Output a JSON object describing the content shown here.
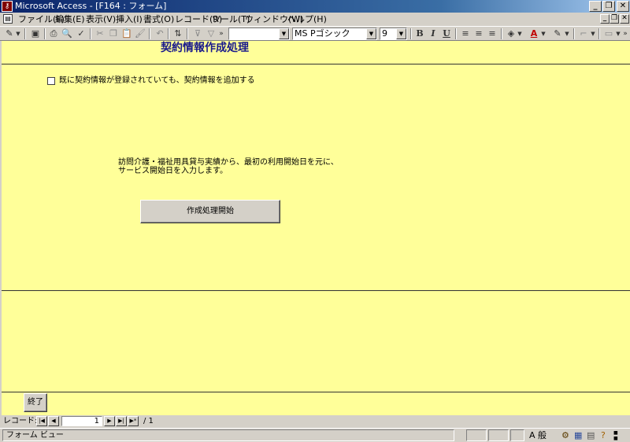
{
  "window": {
    "title": "Microsoft Access - [F164 : フォーム]",
    "minimize": "_",
    "restore": "❐",
    "close": "✕"
  },
  "menubar": {
    "items": [
      "ファイル(F)",
      "編集(E)",
      "表示(V)",
      "挿入(I)",
      "書式(O)",
      "レコード(R)",
      "ツール(T)",
      "ウィンドウ(W)",
      "ヘルプ(H)"
    ]
  },
  "toolbar": {
    "font_name": "MS Pゴシック",
    "font_size": "9",
    "bold": "B",
    "italic": "I",
    "underline": "U",
    "font_color_letter": "A"
  },
  "form": {
    "title": "契約情報作成処理",
    "checkbox_label": "既に契約情報が登録されていても、契約情報を追加する",
    "checkbox_checked": false,
    "info_line1": "訪問介護・福祉用具貸与実績から、最初の利用開始日を元に、",
    "info_line2": "サービス開始日を入力します。",
    "start_button": "作成処理開始",
    "end_button": "終了"
  },
  "navigation": {
    "label": "レコード:",
    "current": "1",
    "total": "/ 1"
  },
  "status": {
    "text": "フォーム ビュー",
    "ime_mode": "A 般"
  }
}
